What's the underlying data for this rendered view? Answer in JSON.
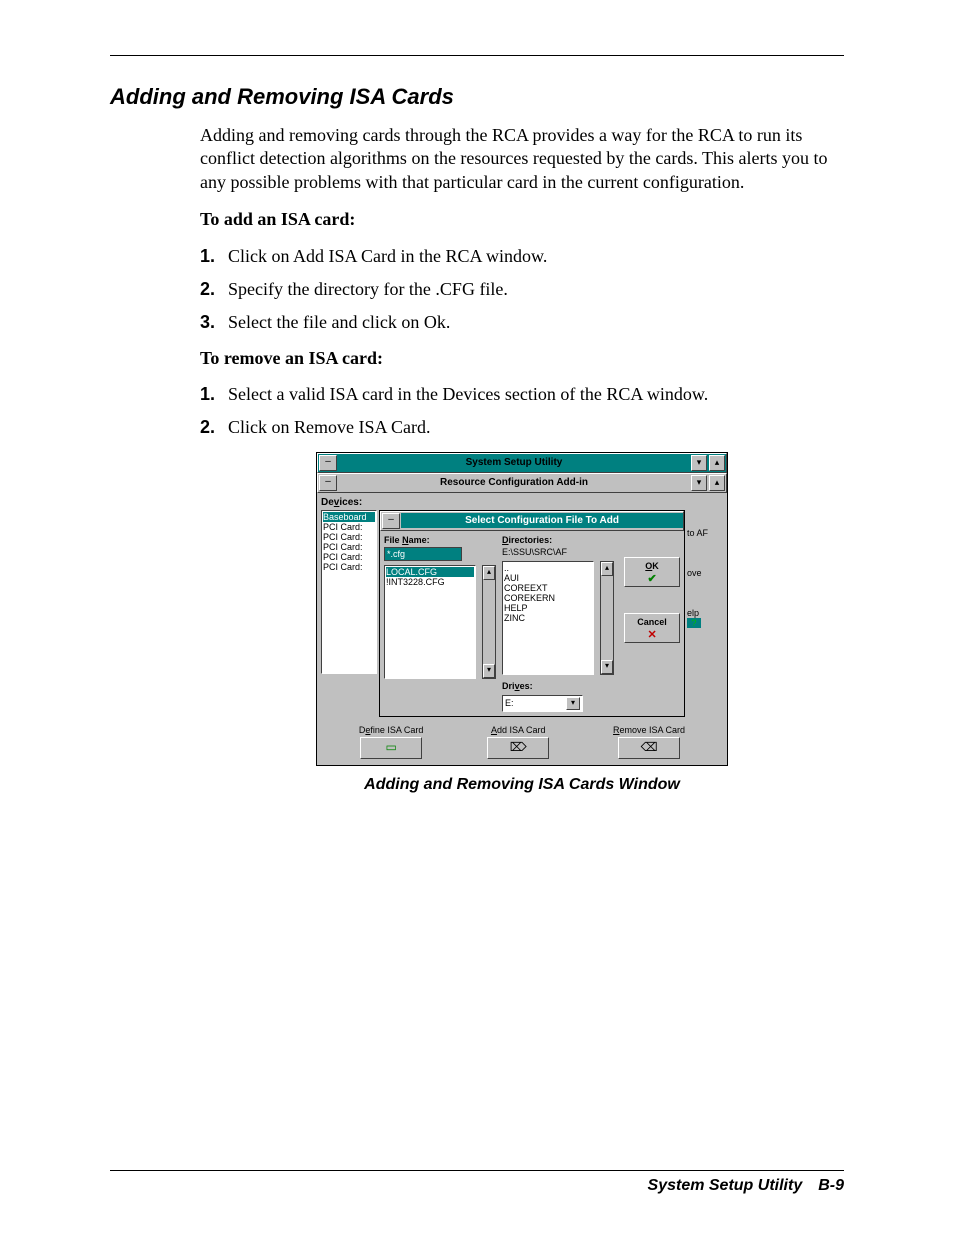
{
  "section_title": "Adding and Removing ISA Cards",
  "intro": "Adding and removing cards through the RCA provides a way for the RCA to run its conflict detection algorithms on the resources requested by the cards. This alerts you to any possible problems with that particular card in the current configuration.",
  "add_heading": "To add an ISA card:",
  "add_steps": [
    "Click on Add ISA Card in the RCA window.",
    "Specify the directory for the .CFG file.",
    "Select the file and click on Ok."
  ],
  "remove_heading": "To remove an ISA card:",
  "remove_steps": [
    "Select a valid ISA card in the Devices section of the RCA window.",
    "Click on Remove ISA Card."
  ],
  "step_numbers": [
    "1.",
    "2.",
    "3."
  ],
  "window": {
    "outer_title": "System Setup Utility",
    "inner_title": "Resource Configuration Add-in",
    "sysmenu_glyph": "–",
    "min_glyph": "▾",
    "max_glyph": "▴",
    "devices_label_pre": "De",
    "devices_label_ul": "v",
    "devices_label_post": "ices:",
    "devices": [
      "Baseboard",
      "PCI Card:",
      "PCI Card:",
      "PCI Card:",
      "PCI Card:",
      "PCI Card:"
    ],
    "dialog_title": "Select Configuration File To Add",
    "file_label_pre": "File ",
    "file_label_ul": "N",
    "file_label_post": "ame:",
    "file_value": "*.cfg",
    "file_list": [
      "LOCAL.CFG",
      "!INT3228.CFG"
    ],
    "dir_label_ul": "D",
    "dir_label_post": "irectories:",
    "dir_value": "E:\\SSU\\SRC\\AF",
    "dir_list": [
      "..",
      "AUI",
      "COREEXT",
      "COREKERN",
      "HELP",
      "ZINC"
    ],
    "drives_label_pre": "Dri",
    "drives_label_ul": "v",
    "drives_label_post": "es:",
    "drives_value": "E:",
    "ok_ul": "O",
    "ok_post": "K",
    "ok_glyph": "✔",
    "cancel_label": "Cancel",
    "cancel_glyph": "✕",
    "side_toaf": "to AF",
    "side_ove": "ove",
    "side_elp": "elp",
    "side_q": "?",
    "def_label_pre": "D",
    "def_label_ul": "e",
    "def_label_post": "fine ISA Card",
    "def_glyph": "▭",
    "add_label_ul": "A",
    "add_label_post": "dd ISA Card",
    "add_glyph": "⌦",
    "rem_label_ul": "R",
    "rem_label_post": "emove ISA Card",
    "rem_glyph": "⌫",
    "scroll_up": "▴",
    "scroll_down": "▾",
    "drop_glyph": "▾"
  },
  "caption": "Adding and Removing ISA Cards Window",
  "footer_text": "System Setup Utility B-9"
}
